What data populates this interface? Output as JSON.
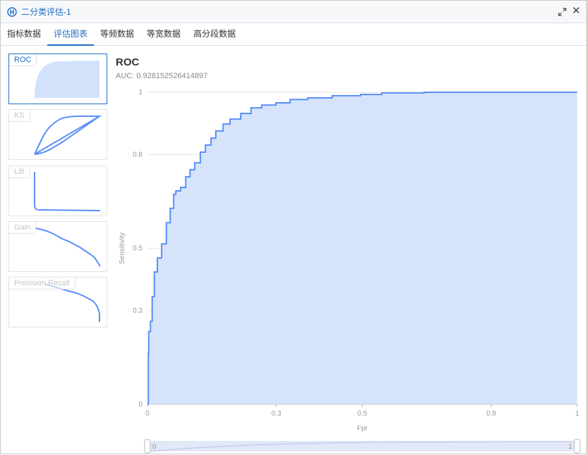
{
  "window": {
    "title": "二分类评估-1",
    "icon": "app-logo-icon",
    "controls": [
      "maximize-icon",
      "close-icon"
    ]
  },
  "tabs": [
    {
      "label": "指标数据",
      "active": false
    },
    {
      "label": "评估图表",
      "active": true
    },
    {
      "label": "等频数据",
      "active": false
    },
    {
      "label": "等宽数据",
      "active": false
    },
    {
      "label": "高分段数据",
      "active": false
    }
  ],
  "thumbnails": [
    {
      "label": "ROC",
      "active": true
    },
    {
      "label": "KS"
    },
    {
      "label": "Lift"
    },
    {
      "label": "Gain"
    },
    {
      "label": "Precision Recall"
    }
  ],
  "colors": {
    "accent": "#1f6fc5",
    "line": "#5b8ff9",
    "fill": "#d3e2fb"
  },
  "chart_data": {
    "type": "area",
    "title": "ROC",
    "subtitle": "AUC: 0.928152526414897",
    "xlabel": "Fpr",
    "ylabel": "Sensitivity",
    "xlim": [
      0,
      1
    ],
    "ylim": [
      0,
      1
    ],
    "xticks": [
      "0",
      "0.3",
      "0.5",
      "0.8",
      "1"
    ],
    "yticks": [
      "0",
      "0.3",
      "0.5",
      "0.8",
      "1"
    ],
    "grid": true,
    "step": true,
    "x": [
      0,
      0.002,
      0.003,
      0.007,
      0.011,
      0.016,
      0.023,
      0.033,
      0.044,
      0.053,
      0.061,
      0.066,
      0.077,
      0.089,
      0.099,
      0.11,
      0.123,
      0.135,
      0.148,
      0.159,
      0.176,
      0.192,
      0.217,
      0.241,
      0.266,
      0.299,
      0.332,
      0.373,
      0.43,
      0.496,
      0.545,
      0.644,
      1
    ],
    "y": [
      0,
      0.165,
      0.233,
      0.266,
      0.345,
      0.424,
      0.469,
      0.514,
      0.582,
      0.628,
      0.673,
      0.684,
      0.695,
      0.729,
      0.752,
      0.774,
      0.808,
      0.831,
      0.853,
      0.876,
      0.898,
      0.914,
      0.932,
      0.95,
      0.959,
      0.966,
      0.977,
      0.982,
      0.989,
      0.993,
      0.998,
      1,
      1
    ],
    "slider": {
      "start": "0",
      "end": "1"
    }
  }
}
